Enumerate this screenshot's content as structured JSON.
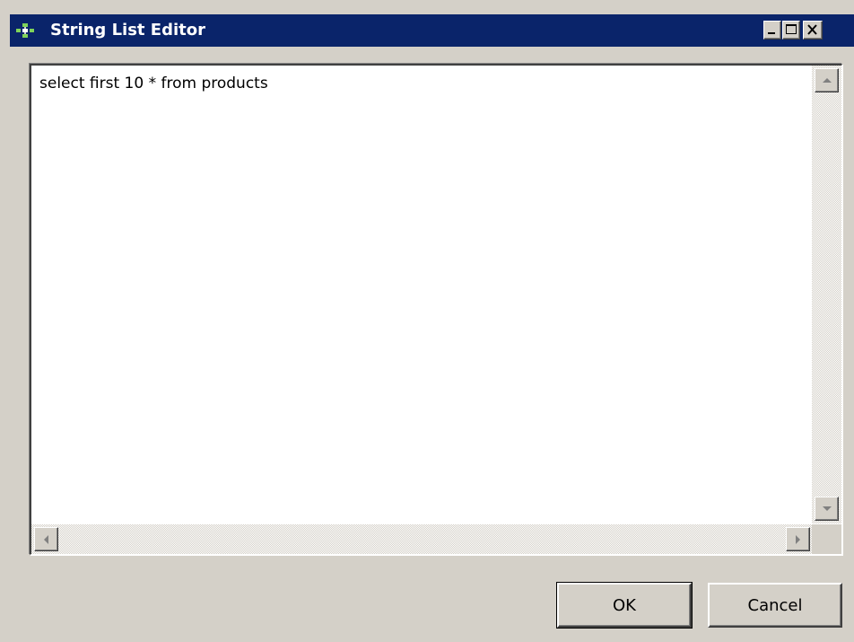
{
  "window": {
    "title": "String List Editor",
    "app_icon": "app-icon",
    "controls": {
      "minimize_icon": "minimize-icon",
      "maximize_icon": "maximize-icon",
      "close_icon": "close-icon"
    }
  },
  "editor": {
    "text": "select first 10 * from products"
  },
  "buttons": {
    "ok_label": "OK",
    "cancel_label": "Cancel"
  },
  "colors": {
    "titlebar": "#0a246a",
    "face": "#d4d0c8",
    "title_text": "#ffffff"
  }
}
